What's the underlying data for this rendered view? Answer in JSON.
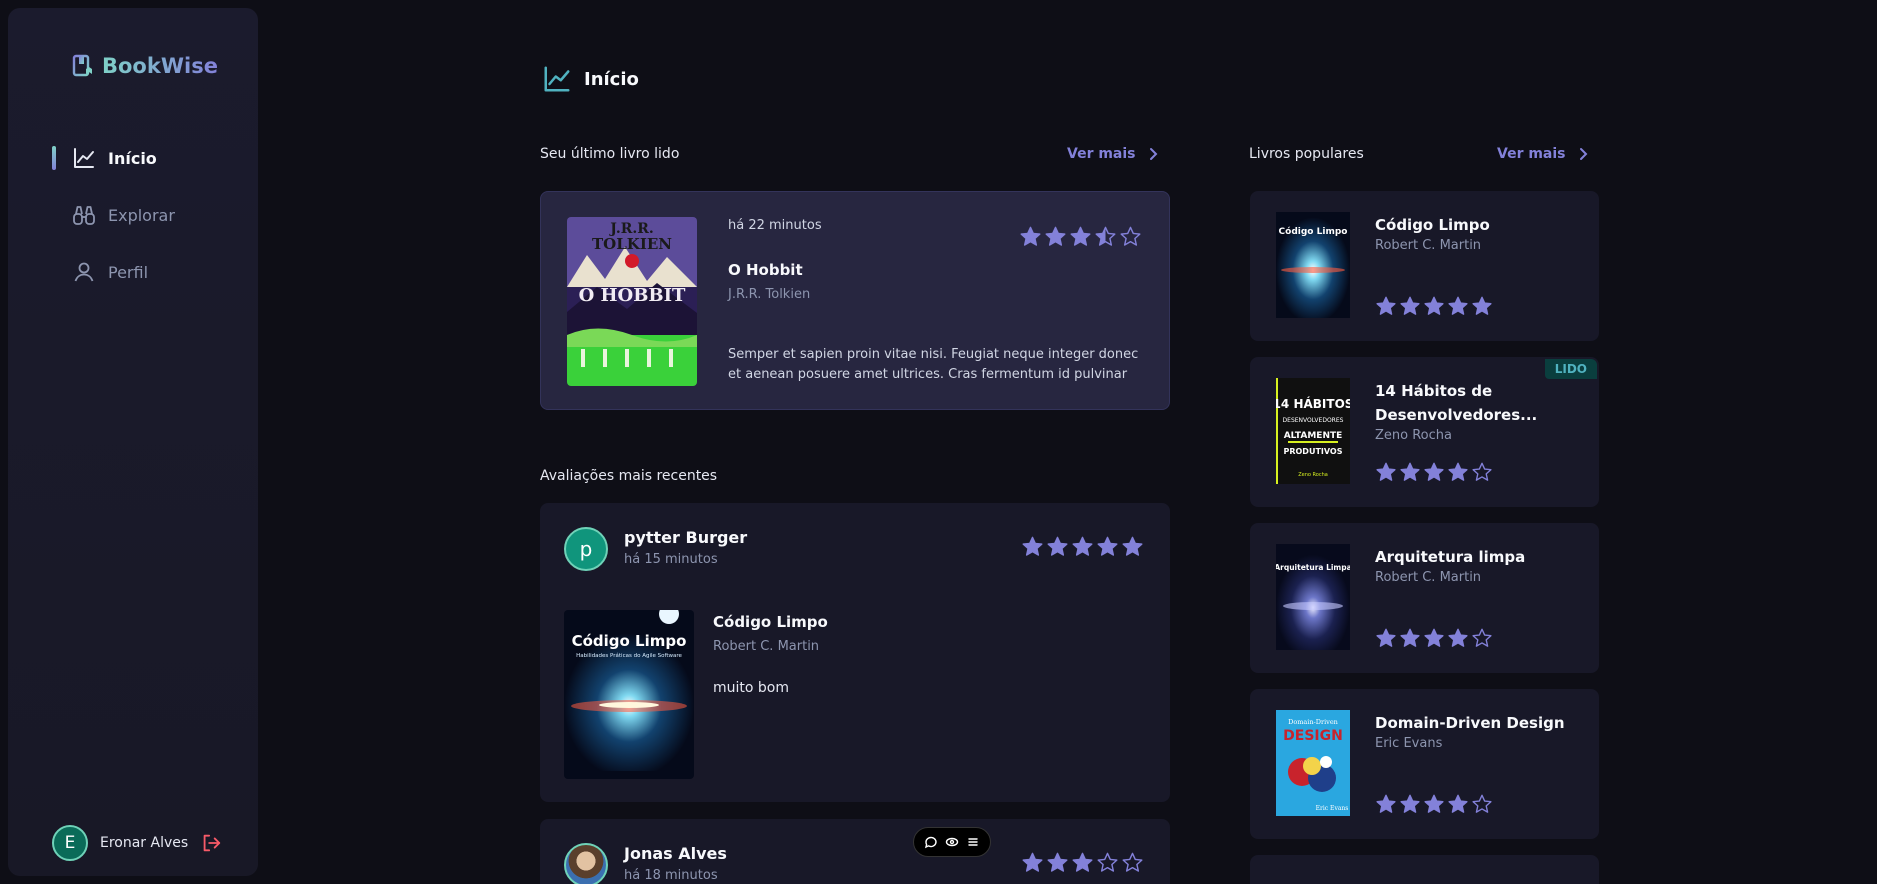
{
  "app": {
    "name": "BookWise"
  },
  "nav": [
    {
      "label": "Início",
      "icon": "chart-line-icon",
      "active": true
    },
    {
      "label": "Explorar",
      "icon": "binoculars-icon",
      "active": false
    },
    {
      "label": "Perfil",
      "icon": "user-icon",
      "active": false
    }
  ],
  "user": {
    "initial": "E",
    "name": "Eronar Alves"
  },
  "header": {
    "title": "Início"
  },
  "last_read": {
    "section_title": "Seu último livro lido",
    "see_more": "Ver mais",
    "time": "há 22 minutos",
    "title": "O Hobbit",
    "author": "J.R.R. Tolkien",
    "description": "Semper et sapien proin vitae nisi. Feugiat neque integer donec et aenean posuere amet ultrices. Cras fermentum id pulvinar varius...",
    "rating": 3.5,
    "cover_text_top": "J.R.R. TOLKIEN",
    "cover_text_title": "O HOBBIT"
  },
  "recent": {
    "section_title": "Avaliações mais recentes",
    "reviews": [
      {
        "initial": "p",
        "name": "pytter Burger",
        "time": "há 15 minutos",
        "rating": 5,
        "book": "Código Limpo",
        "author": "Robert C. Martin",
        "text": "muito bom"
      },
      {
        "name": "Jonas Alves",
        "time": "há 18 minutos",
        "rating": 3
      }
    ]
  },
  "popular": {
    "section_title": "Livros populares",
    "see_more": "Ver mais",
    "books": [
      {
        "title": "Código Limpo",
        "author": "Robert C. Martin",
        "rating": 5,
        "read": false
      },
      {
        "title": "14 Hábitos de Desenvolvedores...",
        "author": "Zeno Rocha",
        "rating": 4,
        "read": true,
        "badge": "LIDO"
      },
      {
        "title": "Arquitetura limpa",
        "author": "Robert C. Martin",
        "rating": 4,
        "read": false
      },
      {
        "title": "Domain-Driven Design",
        "author": "Eric Evans",
        "rating": 4,
        "read": false
      }
    ]
  },
  "colors": {
    "accent": "#8381d9",
    "star": "#8381d9",
    "teal": "#50b2c0",
    "background": "#0e0e16"
  }
}
